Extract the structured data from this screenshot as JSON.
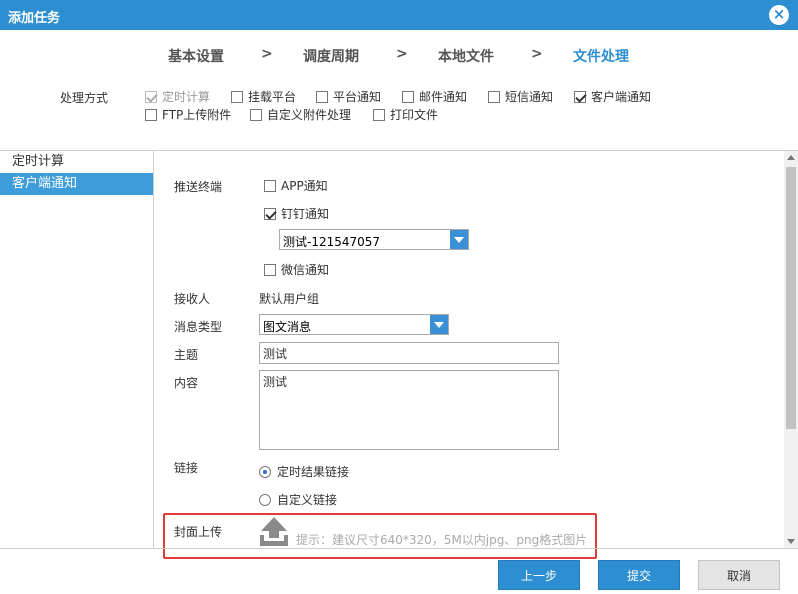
{
  "window": {
    "title": "添加任务"
  },
  "steps": [
    {
      "label": "基本设置"
    },
    {
      "label": "调度周期"
    },
    {
      "label": "本地文件"
    },
    {
      "label": "文件处理"
    }
  ],
  "step_separator": ">",
  "method": {
    "label": "处理方式",
    "options": [
      {
        "label": "定时计算",
        "checked": true,
        "disabled": true
      },
      {
        "label": "挂载平台",
        "checked": false
      },
      {
        "label": "平台通知",
        "checked": false
      },
      {
        "label": "邮件通知",
        "checked": false
      },
      {
        "label": "短信通知",
        "checked": false
      },
      {
        "label": "客户端通知",
        "checked": true
      },
      {
        "label": "FTP上传附件",
        "checked": false
      },
      {
        "label": "自定义附件处理",
        "checked": false
      },
      {
        "label": "打印文件",
        "checked": false
      }
    ]
  },
  "sidebar": {
    "items": [
      {
        "label": "定时计算"
      },
      {
        "label": "客户端通知"
      }
    ]
  },
  "form": {
    "push_label": "推送终端",
    "app_notify": {
      "label": "APP通知",
      "checked": false
    },
    "dingtalk_notify": {
      "label": "钉钉通知",
      "checked": true
    },
    "dingtalk_group": {
      "value": "测试-121547057"
    },
    "wechat_notify": {
      "label": "微信通知",
      "checked": false
    },
    "receiver_label": "接收人",
    "receiver_value": "默认用户组",
    "msg_type_label": "消息类型",
    "msg_type_value": "图文消息",
    "subject_label": "主题",
    "subject_value": "测试",
    "content_label": "内容",
    "content_value": "测试",
    "link_label": "链接",
    "link_options": [
      {
        "label": "定时结果链接",
        "checked": true
      },
      {
        "label": "自定义链接",
        "checked": false
      }
    ],
    "cover_label": "封面上传",
    "cover_hint": "提示：建议尺寸640*320，5M以内jpg、png格式图片"
  },
  "buttons": {
    "prev": "上一步",
    "submit": "提交",
    "cancel": "取消"
  },
  "colors": {
    "accent": "#2d8ed1",
    "highlight_border": "#e03a3a"
  }
}
